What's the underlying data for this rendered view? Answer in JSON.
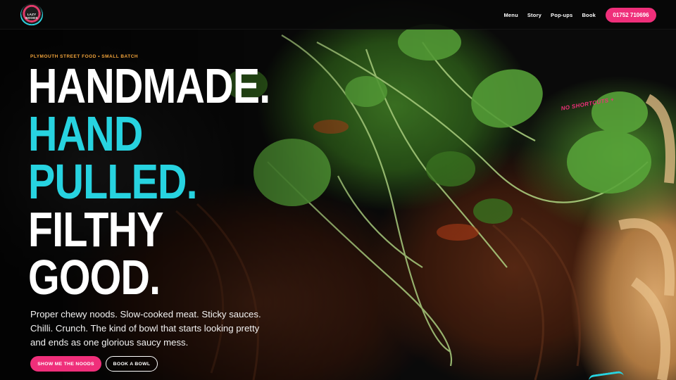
{
  "header": {
    "logo_text": "LAZY NOODS",
    "nav": [
      "Menu",
      "Story",
      "Pop-ups",
      "Book"
    ],
    "phone": "01752 710696"
  },
  "hero": {
    "eyebrow": "PLYMOUTH STREET FOOD • SMALL BATCH",
    "headline": {
      "line1": "HANDMADE.",
      "line2": "HAND",
      "line3": "PULLED.",
      "line4": "FILTHY",
      "line5": "GOOD."
    },
    "lede": "Proper chewy noods. Slow-cooked meat. Sticky sauces. Chilli. Crunch. The kind of bowl that starts looking pretty and ends as one glorious saucy mess.",
    "primary_cta": "SHOW ME THE NOODS",
    "secondary_cta": "BOOK A BOWL",
    "side_tag": "NO SHORTCUTS +"
  },
  "colors": {
    "pink": "#ef2f7a",
    "cyan": "#27d3e0",
    "orange": "#f1a33a",
    "header_bg": "#080808"
  },
  "icons": [
    "logo-badge-icon"
  ]
}
